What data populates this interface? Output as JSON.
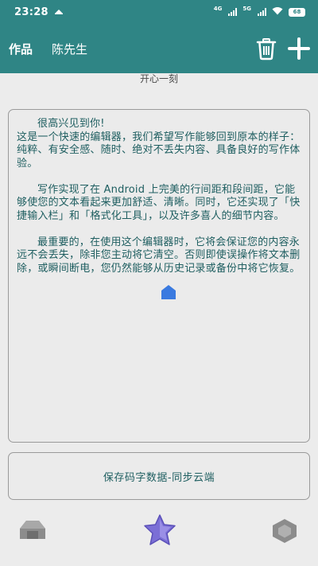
{
  "status_bar": {
    "time": "23:28",
    "network_1": "4G",
    "network_2": "5G",
    "battery": "68"
  },
  "header": {
    "tab_works": "作品",
    "tab_user": "陈先生"
  },
  "subtitle": "开心一刻",
  "editor": {
    "paragraphs": [
      "很高兴见到你!\n这是一个快速的编辑器，我们希望写作能够回到原本的样子：纯粹、有安全感、随时、绝对不丢失内容、具备良好的写作体验。",
      "写作实现了在 Android 上完美的行间距和段间距，它能够使您的文本看起来更加舒适、清晰。同时，它还实现了「快捷输入栏」和「格式化工具」，以及许多喜人的细节内容。",
      "最重要的，在使用这个编辑器时，它将会保证您的内容永远不会丢失，除非您主动将它清空。否则即使误操作将文本删除，或瞬间断电，您仍然能够从历史记录或备份中将它恢复。"
    ]
  },
  "save_button": "保存码字数据-同步云端",
  "colors": {
    "header_bg": "#2f8585",
    "text": "#1e5e60",
    "star": "#7b6fd6",
    "cursor": "#3a7ae0"
  },
  "icons": {
    "trash": "trash-icon",
    "add": "plus-icon",
    "home": "home-icon",
    "star": "star-icon",
    "hexagon": "hexagon-icon"
  }
}
